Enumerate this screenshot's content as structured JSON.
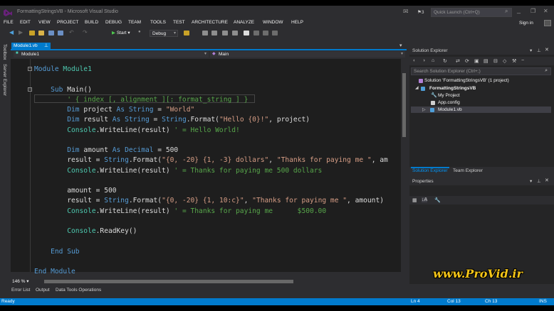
{
  "window": {
    "title": "FormattingStringsVB - Microsoft Visual Studio",
    "notification_count": "3",
    "quick_launch_placeholder": "Quick Launch (Ctrl+Q)"
  },
  "menu": {
    "items": [
      "FILE",
      "EDIT",
      "VIEW",
      "PROJECT",
      "BUILD",
      "DEBUG",
      "TEAM",
      "TOOLS",
      "TEST",
      "ARCHITECTURE",
      "ANALYZE",
      "WINDOW",
      "HELP"
    ],
    "sign_in": "Sign in"
  },
  "toolbar": {
    "start_label": "Start",
    "config_value": "Debug"
  },
  "left_strip": {
    "toolbox": "Toolbox",
    "server_explorer": "Server Explorer"
  },
  "editor": {
    "tab_label": "Module1.vb",
    "nav_left": "Module1",
    "nav_right": "Main",
    "zoom": "146 %",
    "lines": [
      [
        {
          "t": "Module",
          "c": "kw"
        },
        {
          "t": " Module1",
          "c": "ty"
        }
      ],
      [],
      [
        {
          "t": "    Sub",
          "c": "kw"
        },
        {
          "t": " Main()",
          "c": ""
        }
      ],
      [
        {
          "t": "        ' { index [, alignment ][: format_string ] }",
          "c": "cm"
        }
      ],
      [
        {
          "t": "        Dim",
          "c": "kw"
        },
        {
          "t": " project ",
          "c": ""
        },
        {
          "t": "As String",
          "c": "kw"
        },
        {
          "t": " = ",
          "c": ""
        },
        {
          "t": "\"World\"",
          "c": "str"
        }
      ],
      [
        {
          "t": "        Dim",
          "c": "kw"
        },
        {
          "t": " result ",
          "c": ""
        },
        {
          "t": "As String",
          "c": "kw"
        },
        {
          "t": " = ",
          "c": ""
        },
        {
          "t": "String",
          "c": "kw"
        },
        {
          "t": ".Format(",
          "c": ""
        },
        {
          "t": "\"Hello {0}!\"",
          "c": "str"
        },
        {
          "t": ", project)",
          "c": ""
        }
      ],
      [
        {
          "t": "        Console",
          "c": "ty"
        },
        {
          "t": ".WriteLine(result) ",
          "c": ""
        },
        {
          "t": "' = Hello World!",
          "c": "cm"
        }
      ],
      [],
      [
        {
          "t": "        Dim",
          "c": "kw"
        },
        {
          "t": " amount ",
          "c": ""
        },
        {
          "t": "As Decimal",
          "c": "kw"
        },
        {
          "t": " = 500",
          "c": ""
        }
      ],
      [
        {
          "t": "        result = ",
          "c": ""
        },
        {
          "t": "String",
          "c": "kw"
        },
        {
          "t": ".Format(",
          "c": ""
        },
        {
          "t": "\"{0, -20} {1, -3} dollars\"",
          "c": "str"
        },
        {
          "t": ", ",
          "c": ""
        },
        {
          "t": "\"Thanks for paying me \"",
          "c": "str"
        },
        {
          "t": ", am",
          "c": ""
        }
      ],
      [
        {
          "t": "        Console",
          "c": "ty"
        },
        {
          "t": ".WriteLine(result) ",
          "c": ""
        },
        {
          "t": "' = Thanks for paying me 500 dollars",
          "c": "cm"
        }
      ],
      [],
      [
        {
          "t": "        amount = 500",
          "c": ""
        }
      ],
      [
        {
          "t": "        result = ",
          "c": ""
        },
        {
          "t": "String",
          "c": "kw"
        },
        {
          "t": ".Format(",
          "c": ""
        },
        {
          "t": "\"{0, -20} {1, 10:c}\"",
          "c": "str"
        },
        {
          "t": ", ",
          "c": ""
        },
        {
          "t": "\"Thanks for paying me \"",
          "c": "str"
        },
        {
          "t": ", amount)",
          "c": ""
        }
      ],
      [
        {
          "t": "        Console",
          "c": "ty"
        },
        {
          "t": ".WriteLine(result) ",
          "c": ""
        },
        {
          "t": "' = Thanks for paying me      $500.00",
          "c": "cm"
        }
      ],
      [],
      [
        {
          "t": "        Console",
          "c": "ty"
        },
        {
          "t": ".ReadKey()",
          "c": ""
        }
      ],
      [],
      [
        {
          "t": "    End Sub",
          "c": "kw"
        }
      ],
      [],
      [
        {
          "t": "End Module",
          "c": "kw"
        }
      ]
    ]
  },
  "solution_explorer": {
    "title": "Solution Explorer",
    "search_placeholder": "Search Solution Explorer (Ctrl+;)",
    "tree": [
      {
        "label": "Solution 'FormattingStringsVB' (1 project)",
        "bold": false
      },
      {
        "label": "FormattingStringsVB",
        "bold": true
      },
      {
        "label": "My Project",
        "bold": false
      },
      {
        "label": "App.config",
        "bold": false
      },
      {
        "label": "Module1.vb",
        "bold": false
      }
    ],
    "tabs": [
      "Solution Explorer",
      "Team Explorer"
    ]
  },
  "properties": {
    "title": "Properties"
  },
  "bottom_tabs": [
    "Error List",
    "Output",
    "Data Tools Operations"
  ],
  "status": {
    "ready": "Ready",
    "ln": "Ln 4",
    "col": "Col 13",
    "ch": "Ch 13",
    "ins": "INS"
  },
  "watermark": "www.ProVid.ir",
  "colors": {
    "accent": "#007acc",
    "keyword": "#569cd6",
    "type": "#4ec9b0",
    "string": "#d69d85",
    "comment": "#57a64a"
  }
}
